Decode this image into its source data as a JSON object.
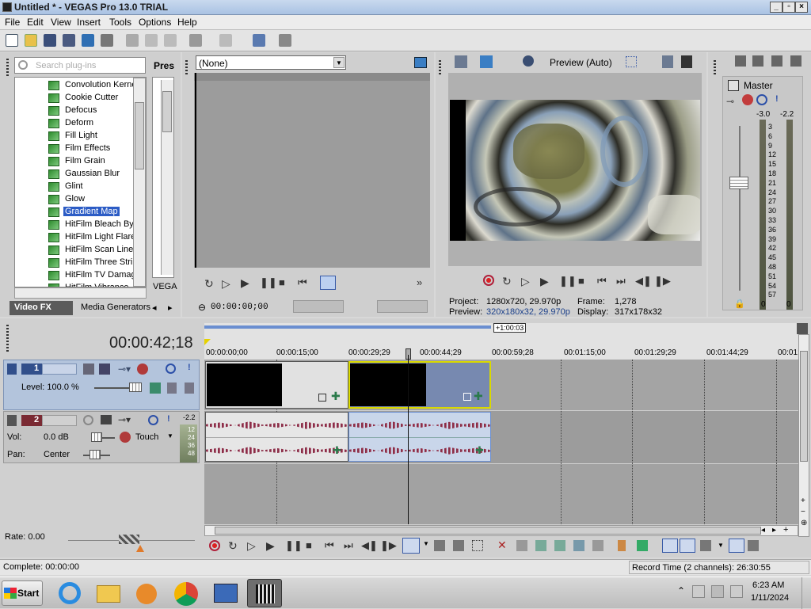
{
  "window": {
    "title": "Untitled * - VEGAS Pro 13.0 TRIAL",
    "controls": [
      "_",
      "▫",
      "×"
    ]
  },
  "menu": [
    "File",
    "Edit",
    "View",
    "Insert",
    "Tools",
    "Options",
    "Help"
  ],
  "plugins": {
    "search_placeholder": "Search plug-ins",
    "items": [
      "Convolution Kernel",
      "Cookie Cutter",
      "Defocus",
      "Deform",
      "Fill Light",
      "Film Effects",
      "Film Grain",
      "Gaussian Blur",
      "Glint",
      "Glow",
      "Gradient Map",
      "HitFilm Bleach Bypass",
      "HitFilm Light Flares",
      "HitFilm Scan Lines",
      "HitFilm Three Strip",
      "HitFilm TV Damage",
      "HitFilm Vibrance"
    ],
    "selected": "Gradient Map",
    "presets_header": "Pres",
    "presets_footer": "VEGA",
    "tabs": [
      "Video FX",
      "Media Generators"
    ]
  },
  "trimmer": {
    "dropdown_value": "(None)",
    "timecode": "00:00:00;00"
  },
  "preview": {
    "mode_label": "Preview (Auto)",
    "project_label": "Project:",
    "project_value": "1280x720, 29.970p",
    "preview_label": "Preview:",
    "preview_value": "320x180x32, 29.970p",
    "frame_label": "Frame:",
    "frame_value": "1,278",
    "display_label": "Display:",
    "display_value": "317x178x32"
  },
  "master": {
    "label": "Master",
    "db_left": "-3.0",
    "db_right": "-2.2",
    "scale": [
      "3",
      "6",
      "9",
      "12",
      "15",
      "18",
      "21",
      "24",
      "27",
      "30",
      "33",
      "36",
      "39",
      "42",
      "45",
      "48",
      "51",
      "54",
      "57"
    ],
    "zero_left": "0",
    "zero_right": "0"
  },
  "timeline": {
    "position": "00:00:42;18",
    "length_marker": "+1:00:03",
    "ruler": [
      "00:00:00;00",
      "00:00:15;00",
      "00:00:29;29",
      "00:00:44;29",
      "00:00:59;28",
      "00:01:15;00",
      "00:01:29;29",
      "00:01:44;29",
      "00:01:5"
    ],
    "track1": {
      "number": "1",
      "level_label": "Level: 100.0 %"
    },
    "track2": {
      "number": "2",
      "vol_label": "Vol:",
      "vol_value": "0.0 dB",
      "pan_label": "Pan:",
      "pan_value": "Center",
      "automation": "Touch",
      "meter_top": "-2.2",
      "meter_ticks": [
        "12",
        "24",
        "36",
        "48"
      ]
    },
    "rate": "Rate: 0.00"
  },
  "status": {
    "left": "Complete: 00:00:00",
    "right": "Record Time (2 channels): 26:30:55"
  },
  "taskbar": {
    "start": "Start",
    "time": "6:23 AM",
    "date": "1/11/2024"
  }
}
